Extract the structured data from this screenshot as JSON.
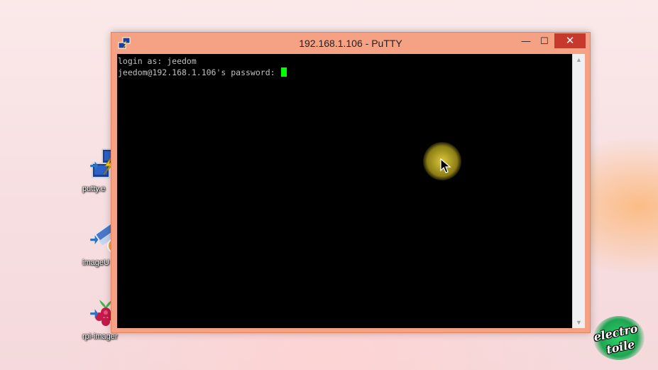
{
  "desktop": {
    "icons": [
      {
        "label": "putty.e",
        "icon": "putty-icon"
      },
      {
        "label": "imageU",
        "icon": "usb-imager-icon"
      },
      {
        "label": "rpi-imager",
        "icon": "raspberry-pi-icon"
      }
    ]
  },
  "window": {
    "title": "192.168.1.106 - PuTTY",
    "controls": {
      "minimize": "—",
      "maximize": "☐",
      "close": "✕"
    },
    "accent": "#f5a183",
    "close_color": "#c7382d"
  },
  "terminal": {
    "lines": [
      "login as: jeedom",
      "jeedom@192.168.1.106's password: "
    ],
    "cursor_color": "#00ff00"
  },
  "watermark": {
    "line1": "electro",
    "line2": "toile"
  }
}
